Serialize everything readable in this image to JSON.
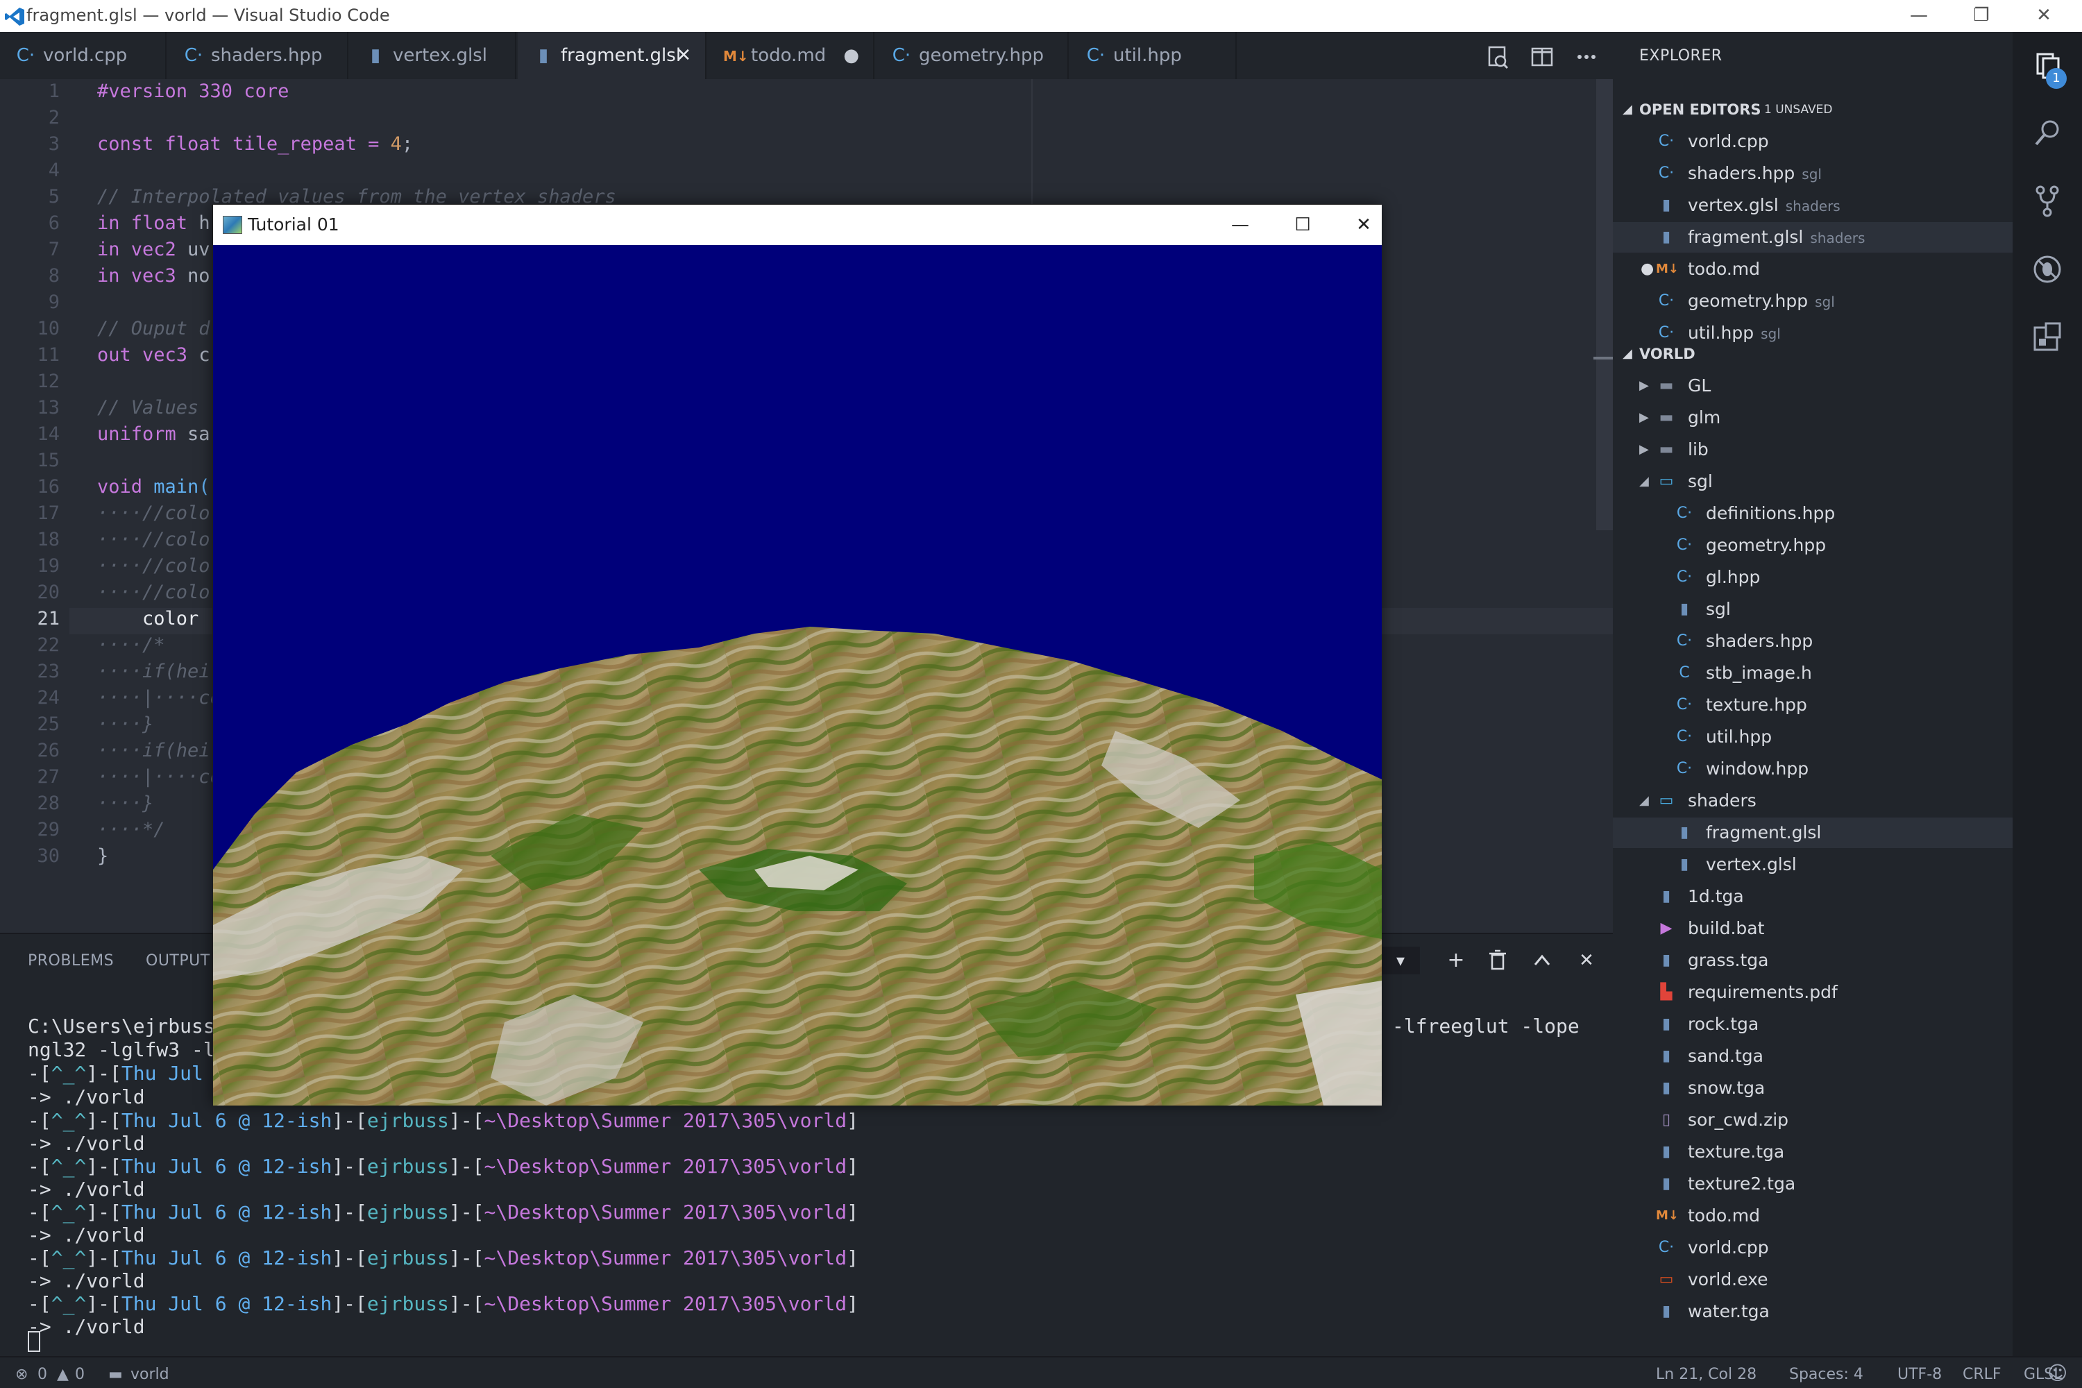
{
  "window": {
    "title": "fragment.glsl — vorld — Visual Studio Code",
    "minimize": "—",
    "restore": "❐",
    "close": "✕"
  },
  "tabs": [
    {
      "label": "vorld.cpp",
      "icon": "cpp-icon"
    },
    {
      "label": "shaders.hpp",
      "icon": "cpp-icon"
    },
    {
      "label": "vertex.glsl",
      "icon": "file-icon"
    },
    {
      "label": "fragment.glsl",
      "icon": "file-icon",
      "active": true,
      "close": "✕"
    },
    {
      "label": "todo.md",
      "icon": "markdown-icon",
      "unsaved": "●"
    },
    {
      "label": "geometry.hpp",
      "icon": "cpp-icon"
    },
    {
      "label": "util.hpp",
      "icon": "cpp-icon"
    }
  ],
  "editor": {
    "lines": [
      "1",
      "2",
      "3",
      "4",
      "5",
      "6",
      "7",
      "8",
      "9",
      "10",
      "11",
      "12",
      "13",
      "14",
      "15",
      "16",
      "17",
      "18",
      "19",
      "20",
      "21",
      "22",
      "23",
      "24",
      "25",
      "26",
      "27",
      "28",
      "29",
      "30"
    ],
    "code": {
      "l1": "#version 330 core",
      "l3a": "const float tile_repeat = ",
      "l3b": "4",
      "l3c": ";",
      "l5": "// Interpolated values from the vertex shaders",
      "l6a": "in float ",
      "l6b": "h",
      "l7a": "in vec2 ",
      "l7b": "uv",
      "l8a": "in vec3 ",
      "l8b": "no",
      "l10": "// Ouput d",
      "l11a": "out vec3 ",
      "l11b": "c",
      "l13": "// Values",
      "l14a": "uniform ",
      "l14b": "sa",
      "l16a": "void ",
      "l16b": "main(",
      "l17": "····//colo",
      "l18": "····//colo",
      "l19": "····//colo",
      "l20": "····//colo",
      "l21": "    color",
      "l22": "····/*",
      "l23": "····if(hei",
      "l24": "····|····co",
      "l25": "····}",
      "l26": "····if(hei",
      "l27": "····|····co",
      "l28": "····}",
      "l29": "····*/",
      "l30": "}"
    }
  },
  "panel": {
    "tabs": [
      "PROBLEMS",
      "OUTPUT"
    ],
    "dropdown": "▾",
    "add": "+",
    "trash": "🗑",
    "up": "^",
    "close": "✕",
    "terminal": {
      "cmd1a": "C:\\Users\\ejrbuss",
      "cmd1b": "-lfreeglut -lope",
      "cmd2": "ngl32 -lglfw3 -l",
      "p1a": "-[",
      "p1b": "^_^",
      "p1c": "]-[",
      "p1d": "Thu Jul",
      "run": "-> ./vorld",
      "prompt": {
        "face": "^_^",
        "date": "Thu Jul 6 @ 12-ish",
        "user": "ejrbuss",
        "path": "~\\Desktop\\Summer 2017\\305\\vorld"
      }
    }
  },
  "status": {
    "errors": "0",
    "warnings": "0",
    "folder": "vorld",
    "position": "Ln 21, Col 28",
    "spaces": "Spaces: 4",
    "encoding": "UTF-8",
    "eol": "CRLF",
    "language": "GLSL",
    "feedback": "☺"
  },
  "sidebar": {
    "header": "EXPLORER",
    "open_editors": {
      "label": "OPEN EDITORS",
      "badge": "1 UNSAVED",
      "items": [
        {
          "name": "vorld.cpp",
          "sub": "",
          "icon": "C·"
        },
        {
          "name": "shaders.hpp",
          "sub": "sgl",
          "icon": "C·"
        },
        {
          "name": "vertex.glsl",
          "sub": "shaders",
          "icon": "▮"
        },
        {
          "name": "fragment.glsl",
          "sub": "shaders",
          "icon": "▮"
        },
        {
          "name": "todo.md",
          "sub": "",
          "icon": "M↓"
        },
        {
          "name": "geometry.hpp",
          "sub": "sgl",
          "icon": "C·"
        },
        {
          "name": "util.hpp",
          "sub": "sgl",
          "icon": "C·"
        }
      ]
    },
    "project": {
      "label": "VORLD",
      "items": [
        {
          "name": "GL",
          "indent": 0,
          "type": "folder"
        },
        {
          "name": "glm",
          "indent": 0,
          "type": "folder"
        },
        {
          "name": "lib",
          "indent": 0,
          "type": "folder"
        },
        {
          "name": "sgl",
          "indent": 0,
          "type": "folder-open"
        },
        {
          "name": "definitions.hpp",
          "indent": 1,
          "type": "cpp"
        },
        {
          "name": "geometry.hpp",
          "indent": 1,
          "type": "cpp"
        },
        {
          "name": "gl.hpp",
          "indent": 1,
          "type": "cpp"
        },
        {
          "name": "sgl",
          "indent": 1,
          "type": "file"
        },
        {
          "name": "shaders.hpp",
          "indent": 1,
          "type": "cpp"
        },
        {
          "name": "stb_image.h",
          "indent": 1,
          "type": "c"
        },
        {
          "name": "texture.hpp",
          "indent": 1,
          "type": "cpp"
        },
        {
          "name": "util.hpp",
          "indent": 1,
          "type": "cpp"
        },
        {
          "name": "window.hpp",
          "indent": 1,
          "type": "cpp"
        },
        {
          "name": "shaders",
          "indent": 0,
          "type": "folder-open"
        },
        {
          "name": "fragment.glsl",
          "indent": 1,
          "type": "file"
        },
        {
          "name": "vertex.glsl",
          "indent": 1,
          "type": "file"
        },
        {
          "name": "1d.tga",
          "indent": 0,
          "type": "file"
        },
        {
          "name": "build.bat",
          "indent": 0,
          "type": "bat"
        },
        {
          "name": "grass.tga",
          "indent": 0,
          "type": "file"
        },
        {
          "name": "requirements.pdf",
          "indent": 0,
          "type": "pdf"
        },
        {
          "name": "rock.tga",
          "indent": 0,
          "type": "file"
        },
        {
          "name": "sand.tga",
          "indent": 0,
          "type": "file"
        },
        {
          "name": "snow.tga",
          "indent": 0,
          "type": "file"
        },
        {
          "name": "sor_cwd.zip",
          "indent": 0,
          "type": "zip"
        },
        {
          "name": "texture.tga",
          "indent": 0,
          "type": "file"
        },
        {
          "name": "texture2.tga",
          "indent": 0,
          "type": "file"
        },
        {
          "name": "todo.md",
          "indent": 0,
          "type": "md"
        },
        {
          "name": "vorld.cpp",
          "indent": 0,
          "type": "cpp"
        },
        {
          "name": "vorld.exe",
          "indent": 0,
          "type": "exe"
        },
        {
          "name": "water.tga",
          "indent": 0,
          "type": "file"
        }
      ]
    }
  },
  "activity": {
    "badge": "1",
    "icons": [
      "files-icon",
      "search-icon",
      "source-control-icon",
      "debug-icon",
      "extensions-icon"
    ]
  },
  "glwindow": {
    "title": "Tutorial 01",
    "minimize": "—",
    "maximize": "☐",
    "close": "✕",
    "sky_color": "#00007a"
  },
  "colors": {
    "accent": "#3f8bd8",
    "editor_bg": "#282c34",
    "sidebar_bg": "#21252b"
  }
}
